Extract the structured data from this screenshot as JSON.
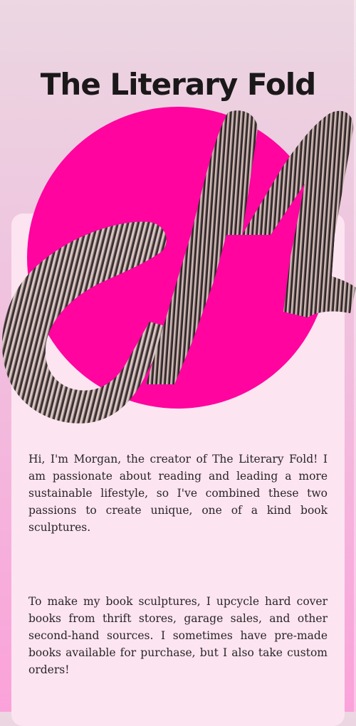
{
  "header": {
    "title": "The Literary Fold"
  },
  "logo": {
    "icon": "folded-book-letter-m-logo",
    "circle_color": "#ff049f"
  },
  "about": {
    "paragraphs": [
      "Hi, I'm Morgan, the creator of The Literary Fold! I am passionate about reading and leading a more sustainable lifestyle, so I've combined these two passions to create unique, one of a kind book sculptures.",
      "To make my book sculptures, I upcycle hard cover books from thrift stores, garage sales, and other second-hand sources. I sometimes have pre-made books available for purchase, but I also take custom orders!"
    ]
  },
  "colors": {
    "card_background": "#fce4f1",
    "text": "#2a2526",
    "accent": "#ff049f"
  }
}
